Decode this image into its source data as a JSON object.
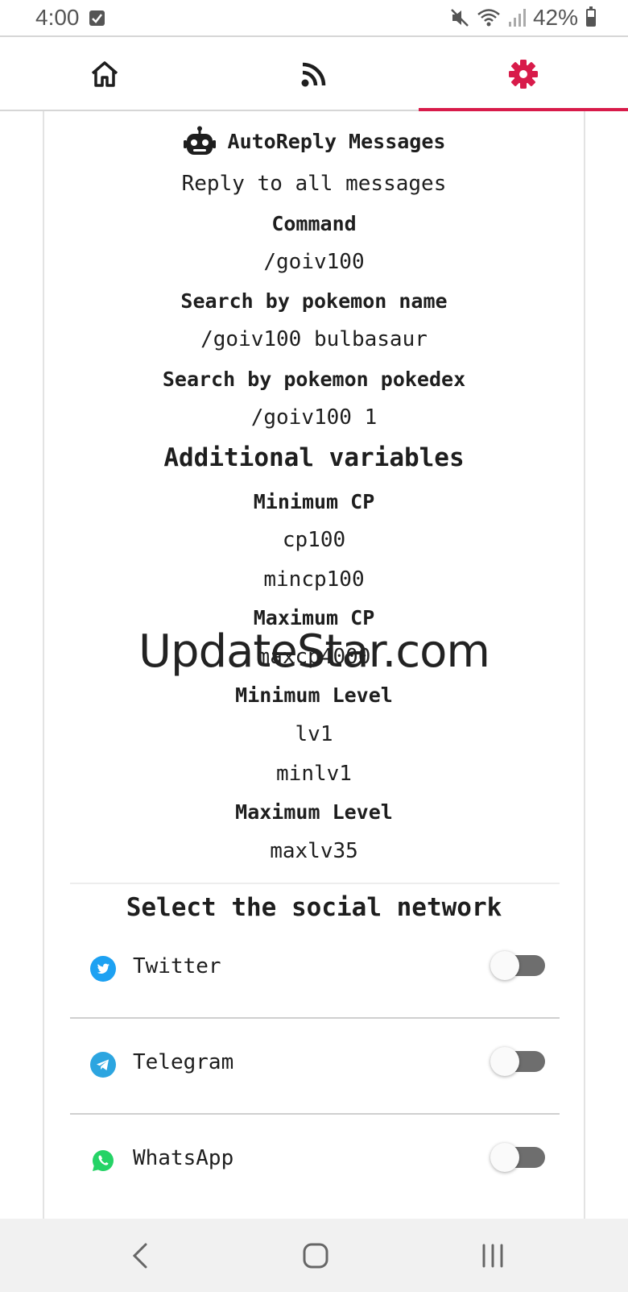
{
  "status_bar": {
    "time": "4:00",
    "battery_percent": "42%",
    "battery_level": 0.42
  },
  "tabs": [
    {
      "name": "home",
      "icon": "home-icon",
      "selected": false
    },
    {
      "name": "feed",
      "icon": "rss-icon",
      "selected": false
    },
    {
      "name": "settings",
      "icon": "gear-icon",
      "selected": true
    }
  ],
  "accent_color": "#d81b4a",
  "autoreply": {
    "title": "AutoReply Messages",
    "title_icon": "robot-icon",
    "subtitle": "Reply to all messages",
    "command_label": "Command",
    "command_value": "/goiv100",
    "search_name_label": "Search by pokemon name",
    "search_name_value": "/goiv100 bulbasaur",
    "search_dex_label": "Search by pokemon pokedex",
    "search_dex_value": "/goiv100 1",
    "additional_title": "Additional variables",
    "min_cp_label": "Minimum CP",
    "min_cp_value_1": "cp100",
    "min_cp_value_2": "mincp100",
    "max_cp_label": "Maximum CP",
    "max_cp_value": "maxcp4000",
    "min_level_label": "Minimum Level",
    "min_level_value_1": "lv1",
    "min_level_value_2": "minlv1",
    "max_level_label": "Maximum Level",
    "max_level_value": "maxlv35"
  },
  "social": {
    "title": "Select the social network",
    "networks": [
      {
        "label": "Twitter",
        "icon": "twitter-icon",
        "color": "#1da1f2",
        "enabled": false
      },
      {
        "label": "Telegram",
        "icon": "telegram-icon",
        "color": "#2ca5e0",
        "enabled": false
      },
      {
        "label": "WhatsApp",
        "icon": "whatsapp-icon",
        "color": "#25d366",
        "enabled": false
      }
    ]
  },
  "watermark": "UpdateStar.com"
}
